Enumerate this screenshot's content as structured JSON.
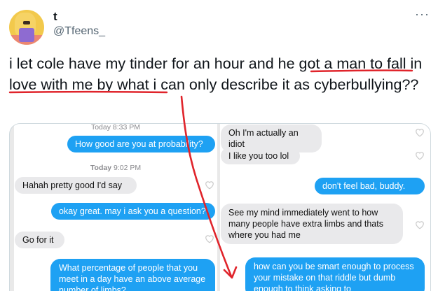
{
  "author": {
    "display_name": "t",
    "handle": "@Tfeens_",
    "more_glyph": "···"
  },
  "tweet": {
    "text_part1": "i let cole have my tinder for an hour and ",
    "text_highlight": "he got a man to fall in love with me",
    "text_part2": " by what i can only describe it as cyberbullying??"
  },
  "chat_left": {
    "timestamp_top": "Today 8:33 PM",
    "timestamp_mid_day": "Today",
    "timestamp_mid_time": "9:02 PM",
    "messages": [
      {
        "from": "me",
        "text": "How good are you at probability?"
      },
      {
        "from": "them",
        "text": "Hahah pretty good I'd say"
      },
      {
        "from": "me",
        "text": "okay great. may i ask you a question?"
      },
      {
        "from": "them",
        "text": "Go for it"
      },
      {
        "from": "me",
        "text": "What percentage of people that you meet in a day have an above average number of limbs?"
      }
    ]
  },
  "chat_right": {
    "messages": [
      {
        "from": "them",
        "text": "Oh I'm actually an idiot"
      },
      {
        "from": "them",
        "text": "I like you too lol"
      },
      {
        "from": "me",
        "text": "don't feel bad, buddy."
      },
      {
        "from": "them",
        "text": "See my mind immediately went to how many people have extra limbs and thats where you had me"
      },
      {
        "from": "me",
        "text": "how can you be smart enough to process your mistake on that riddle but dumb enough to think asking to"
      }
    ]
  },
  "colors": {
    "accent_blue": "#1ea1f3",
    "bubble_gray": "#e9e9eb",
    "annotation_red": "#e0242b"
  },
  "icons": [
    "more-horizontal-icon",
    "heart-outline-icon"
  ]
}
